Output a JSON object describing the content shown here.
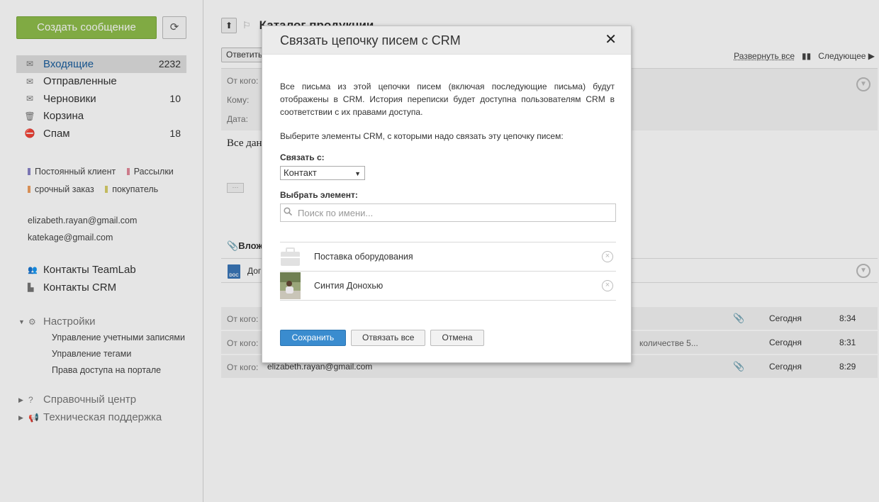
{
  "sidebar": {
    "new_message": "Создать сообщение",
    "refresh_icon": "refresh-icon",
    "folders": [
      {
        "label": "Входящие",
        "count": "2232",
        "icon": "inbox-icon"
      },
      {
        "label": "Отправленные",
        "count": "",
        "icon": "sent-icon"
      },
      {
        "label": "Черновики",
        "count": "10",
        "icon": "drafts-icon"
      },
      {
        "label": "Корзина",
        "count": "",
        "icon": "trash-icon"
      },
      {
        "label": "Спам",
        "count": "18",
        "icon": "spam-icon"
      }
    ],
    "tags": [
      {
        "label": "Постоянный клиент",
        "color": "#8a84c8"
      },
      {
        "label": "Рассылки",
        "color": "#e4899a"
      },
      {
        "label": "срочный заказ",
        "color": "#f0a060"
      },
      {
        "label": "покупатель",
        "color": "#d9d06a"
      }
    ],
    "accounts": [
      "elizabeth.rayan@gmail.com",
      "katekage@gmail.com"
    ],
    "contacts": [
      "Контакты TeamLab",
      "Контакты CRM"
    ],
    "settings": {
      "label": "Настройки",
      "items": [
        "Управление учетными записями",
        "Управление тегами",
        "Права доступа на портале"
      ]
    },
    "help": "Справочный центр",
    "support": "Техническая поддержка"
  },
  "main": {
    "subject": "Каталог продукции",
    "reply": "Ответить",
    "expand_all": "Развернуть все",
    "next": "Следующее",
    "from_label": "От кого:",
    "to_label": "Кому:",
    "date_label": "Дата:",
    "body_preview": "Все дан",
    "attachments_label": "Вложе",
    "attachment_name": "Дог",
    "messages": [
      {
        "from": "",
        "snippet": "",
        "date": "Сегодня",
        "time": "8:34",
        "attachment": true
      },
      {
        "from": "",
        "snippet": "количестве 5...",
        "date": "Сегодня",
        "time": "8:31",
        "attachment": false
      },
      {
        "from": "elizabeth.rayan@gmail.com",
        "snippet": "",
        "date": "Сегодня",
        "time": "8:29",
        "attachment": true
      }
    ]
  },
  "modal": {
    "title": "Связать цепочку писем с CRM",
    "description": "Все письма из этой цепочки писем (включая последующие письма) будут отображены в CRM. История переписки будет доступна пользователям CRM в соответствии с их правами доступа.",
    "choose": "Выберите элементы CRM, с которыми надо связать эту цепочку писем:",
    "link_label": "Связать с:",
    "link_value": "Контакт",
    "pick_label": "Выбрать элемент:",
    "search_placeholder": "Поиск по имени...",
    "items": [
      {
        "name": "Поставка оборудования",
        "icon": "case-icon"
      },
      {
        "name": "Синтия Донохью",
        "icon": "contact-photo"
      }
    ],
    "save": "Сохранить",
    "unlink_all": "Отвязать все",
    "cancel": "Отмена"
  }
}
